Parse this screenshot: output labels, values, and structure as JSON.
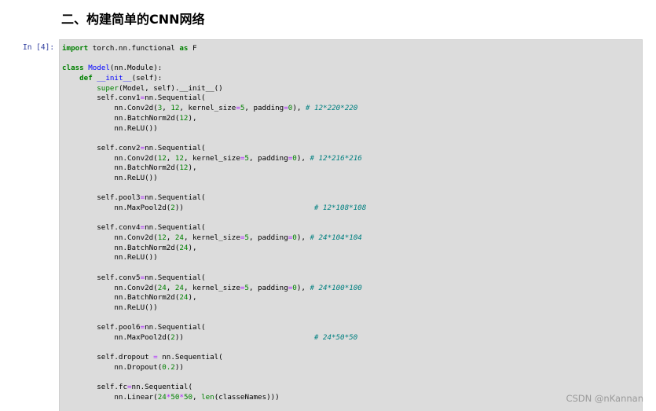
{
  "section_heading": "二、构建简单的CNN网络",
  "cell": {
    "prompt": "In [4]:",
    "lines": [
      [
        {
          "t": "import",
          "c": "kw"
        },
        {
          "t": " torch.nn.functional ",
          "c": "plain"
        },
        {
          "t": "as",
          "c": "kw"
        },
        {
          "t": " F",
          "c": "plain"
        }
      ],
      [],
      [
        {
          "t": "class",
          "c": "kw"
        },
        {
          "t": " ",
          "c": "plain"
        },
        {
          "t": "Model",
          "c": "func"
        },
        {
          "t": "(nn.Module):",
          "c": "plain"
        }
      ],
      [
        {
          "t": "    ",
          "c": "plain"
        },
        {
          "t": "def",
          "c": "kw"
        },
        {
          "t": " ",
          "c": "plain"
        },
        {
          "t": "__init__",
          "c": "func"
        },
        {
          "t": "(self):",
          "c": "plain"
        }
      ],
      [
        {
          "t": "        ",
          "c": "plain"
        },
        {
          "t": "super",
          "c": "builtin"
        },
        {
          "t": "(Model, self).__init__()",
          "c": "plain"
        }
      ],
      [
        {
          "t": "        self.conv1",
          "c": "plain"
        },
        {
          "t": "=",
          "c": "op"
        },
        {
          "t": "nn.Sequential(",
          "c": "plain"
        }
      ],
      [
        {
          "t": "            nn.Conv2d(",
          "c": "plain"
        },
        {
          "t": "3",
          "c": "num"
        },
        {
          "t": ", ",
          "c": "plain"
        },
        {
          "t": "12",
          "c": "num"
        },
        {
          "t": ", kernel_size",
          "c": "plain"
        },
        {
          "t": "=",
          "c": "op"
        },
        {
          "t": "5",
          "c": "num"
        },
        {
          "t": ", padding",
          "c": "plain"
        },
        {
          "t": "=",
          "c": "op"
        },
        {
          "t": "0",
          "c": "num"
        },
        {
          "t": "), ",
          "c": "plain"
        },
        {
          "t": "# 12*220*220",
          "c": "comment"
        }
      ],
      [
        {
          "t": "            nn.BatchNorm2d(",
          "c": "plain"
        },
        {
          "t": "12",
          "c": "num"
        },
        {
          "t": "),",
          "c": "plain"
        }
      ],
      [
        {
          "t": "            nn.ReLU())",
          "c": "plain"
        }
      ],
      [],
      [
        {
          "t": "        self.conv2",
          "c": "plain"
        },
        {
          "t": "=",
          "c": "op"
        },
        {
          "t": "nn.Sequential(",
          "c": "plain"
        }
      ],
      [
        {
          "t": "            nn.Conv2d(",
          "c": "plain"
        },
        {
          "t": "12",
          "c": "num"
        },
        {
          "t": ", ",
          "c": "plain"
        },
        {
          "t": "12",
          "c": "num"
        },
        {
          "t": ", kernel_size",
          "c": "plain"
        },
        {
          "t": "=",
          "c": "op"
        },
        {
          "t": "5",
          "c": "num"
        },
        {
          "t": ", padding",
          "c": "plain"
        },
        {
          "t": "=",
          "c": "op"
        },
        {
          "t": "0",
          "c": "num"
        },
        {
          "t": "), ",
          "c": "plain"
        },
        {
          "t": "# 12*216*216",
          "c": "comment"
        }
      ],
      [
        {
          "t": "            nn.BatchNorm2d(",
          "c": "plain"
        },
        {
          "t": "12",
          "c": "num"
        },
        {
          "t": "),",
          "c": "plain"
        }
      ],
      [
        {
          "t": "            nn.ReLU())",
          "c": "plain"
        }
      ],
      [],
      [
        {
          "t": "        self.pool3",
          "c": "plain"
        },
        {
          "t": "=",
          "c": "op"
        },
        {
          "t": "nn.Sequential(",
          "c": "plain"
        }
      ],
      [
        {
          "t": "            nn.MaxPool2d(",
          "c": "plain"
        },
        {
          "t": "2",
          "c": "num"
        },
        {
          "t": "))                              ",
          "c": "plain"
        },
        {
          "t": "# 12*108*108",
          "c": "comment"
        }
      ],
      [],
      [
        {
          "t": "        self.conv4",
          "c": "plain"
        },
        {
          "t": "=",
          "c": "op"
        },
        {
          "t": "nn.Sequential(",
          "c": "plain"
        }
      ],
      [
        {
          "t": "            nn.Conv2d(",
          "c": "plain"
        },
        {
          "t": "12",
          "c": "num"
        },
        {
          "t": ", ",
          "c": "plain"
        },
        {
          "t": "24",
          "c": "num"
        },
        {
          "t": ", kernel_size",
          "c": "plain"
        },
        {
          "t": "=",
          "c": "op"
        },
        {
          "t": "5",
          "c": "num"
        },
        {
          "t": ", padding",
          "c": "plain"
        },
        {
          "t": "=",
          "c": "op"
        },
        {
          "t": "0",
          "c": "num"
        },
        {
          "t": "), ",
          "c": "plain"
        },
        {
          "t": "# 24*104*104",
          "c": "comment"
        }
      ],
      [
        {
          "t": "            nn.BatchNorm2d(",
          "c": "plain"
        },
        {
          "t": "24",
          "c": "num"
        },
        {
          "t": "),",
          "c": "plain"
        }
      ],
      [
        {
          "t": "            nn.ReLU())",
          "c": "plain"
        }
      ],
      [],
      [
        {
          "t": "        self.conv5",
          "c": "plain"
        },
        {
          "t": "=",
          "c": "op"
        },
        {
          "t": "nn.Sequential(",
          "c": "plain"
        }
      ],
      [
        {
          "t": "            nn.Conv2d(",
          "c": "plain"
        },
        {
          "t": "24",
          "c": "num"
        },
        {
          "t": ", ",
          "c": "plain"
        },
        {
          "t": "24",
          "c": "num"
        },
        {
          "t": ", kernel_size",
          "c": "plain"
        },
        {
          "t": "=",
          "c": "op"
        },
        {
          "t": "5",
          "c": "num"
        },
        {
          "t": ", padding",
          "c": "plain"
        },
        {
          "t": "=",
          "c": "op"
        },
        {
          "t": "0",
          "c": "num"
        },
        {
          "t": "), ",
          "c": "plain"
        },
        {
          "t": "# 24*100*100",
          "c": "comment"
        }
      ],
      [
        {
          "t": "            nn.BatchNorm2d(",
          "c": "plain"
        },
        {
          "t": "24",
          "c": "num"
        },
        {
          "t": "),",
          "c": "plain"
        }
      ],
      [
        {
          "t": "            nn.ReLU())",
          "c": "plain"
        }
      ],
      [],
      [
        {
          "t": "        self.pool6",
          "c": "plain"
        },
        {
          "t": "=",
          "c": "op"
        },
        {
          "t": "nn.Sequential(",
          "c": "plain"
        }
      ],
      [
        {
          "t": "            nn.MaxPool2d(",
          "c": "plain"
        },
        {
          "t": "2",
          "c": "num"
        },
        {
          "t": "))                              ",
          "c": "plain"
        },
        {
          "t": "# 24*50*50",
          "c": "comment"
        }
      ],
      [],
      [
        {
          "t": "        self.dropout ",
          "c": "plain"
        },
        {
          "t": "=",
          "c": "op"
        },
        {
          "t": " nn.Sequential(",
          "c": "plain"
        }
      ],
      [
        {
          "t": "            nn.Dropout(",
          "c": "plain"
        },
        {
          "t": "0.2",
          "c": "num"
        },
        {
          "t": "))",
          "c": "plain"
        }
      ],
      [],
      [
        {
          "t": "        self.fc",
          "c": "plain"
        },
        {
          "t": "=",
          "c": "op"
        },
        {
          "t": "nn.Sequential(",
          "c": "plain"
        }
      ],
      [
        {
          "t": "            nn.Linear(",
          "c": "plain"
        },
        {
          "t": "24",
          "c": "num"
        },
        {
          "t": "*",
          "c": "op"
        },
        {
          "t": "50",
          "c": "num"
        },
        {
          "t": "*",
          "c": "op"
        },
        {
          "t": "50",
          "c": "num"
        },
        {
          "t": ", ",
          "c": "plain"
        },
        {
          "t": "len",
          "c": "builtin"
        },
        {
          "t": "(classeNames)))",
          "c": "plain"
        }
      ]
    ]
  },
  "watermark": "CSDN @nKannan",
  "colors": {
    "cell_background": "#dcdcdc",
    "prompt": "#303f9f",
    "keyword": "#008000",
    "function_name": "#0000ff",
    "number": "#008000",
    "comment": "#008080",
    "operator": "#aa22ff"
  }
}
